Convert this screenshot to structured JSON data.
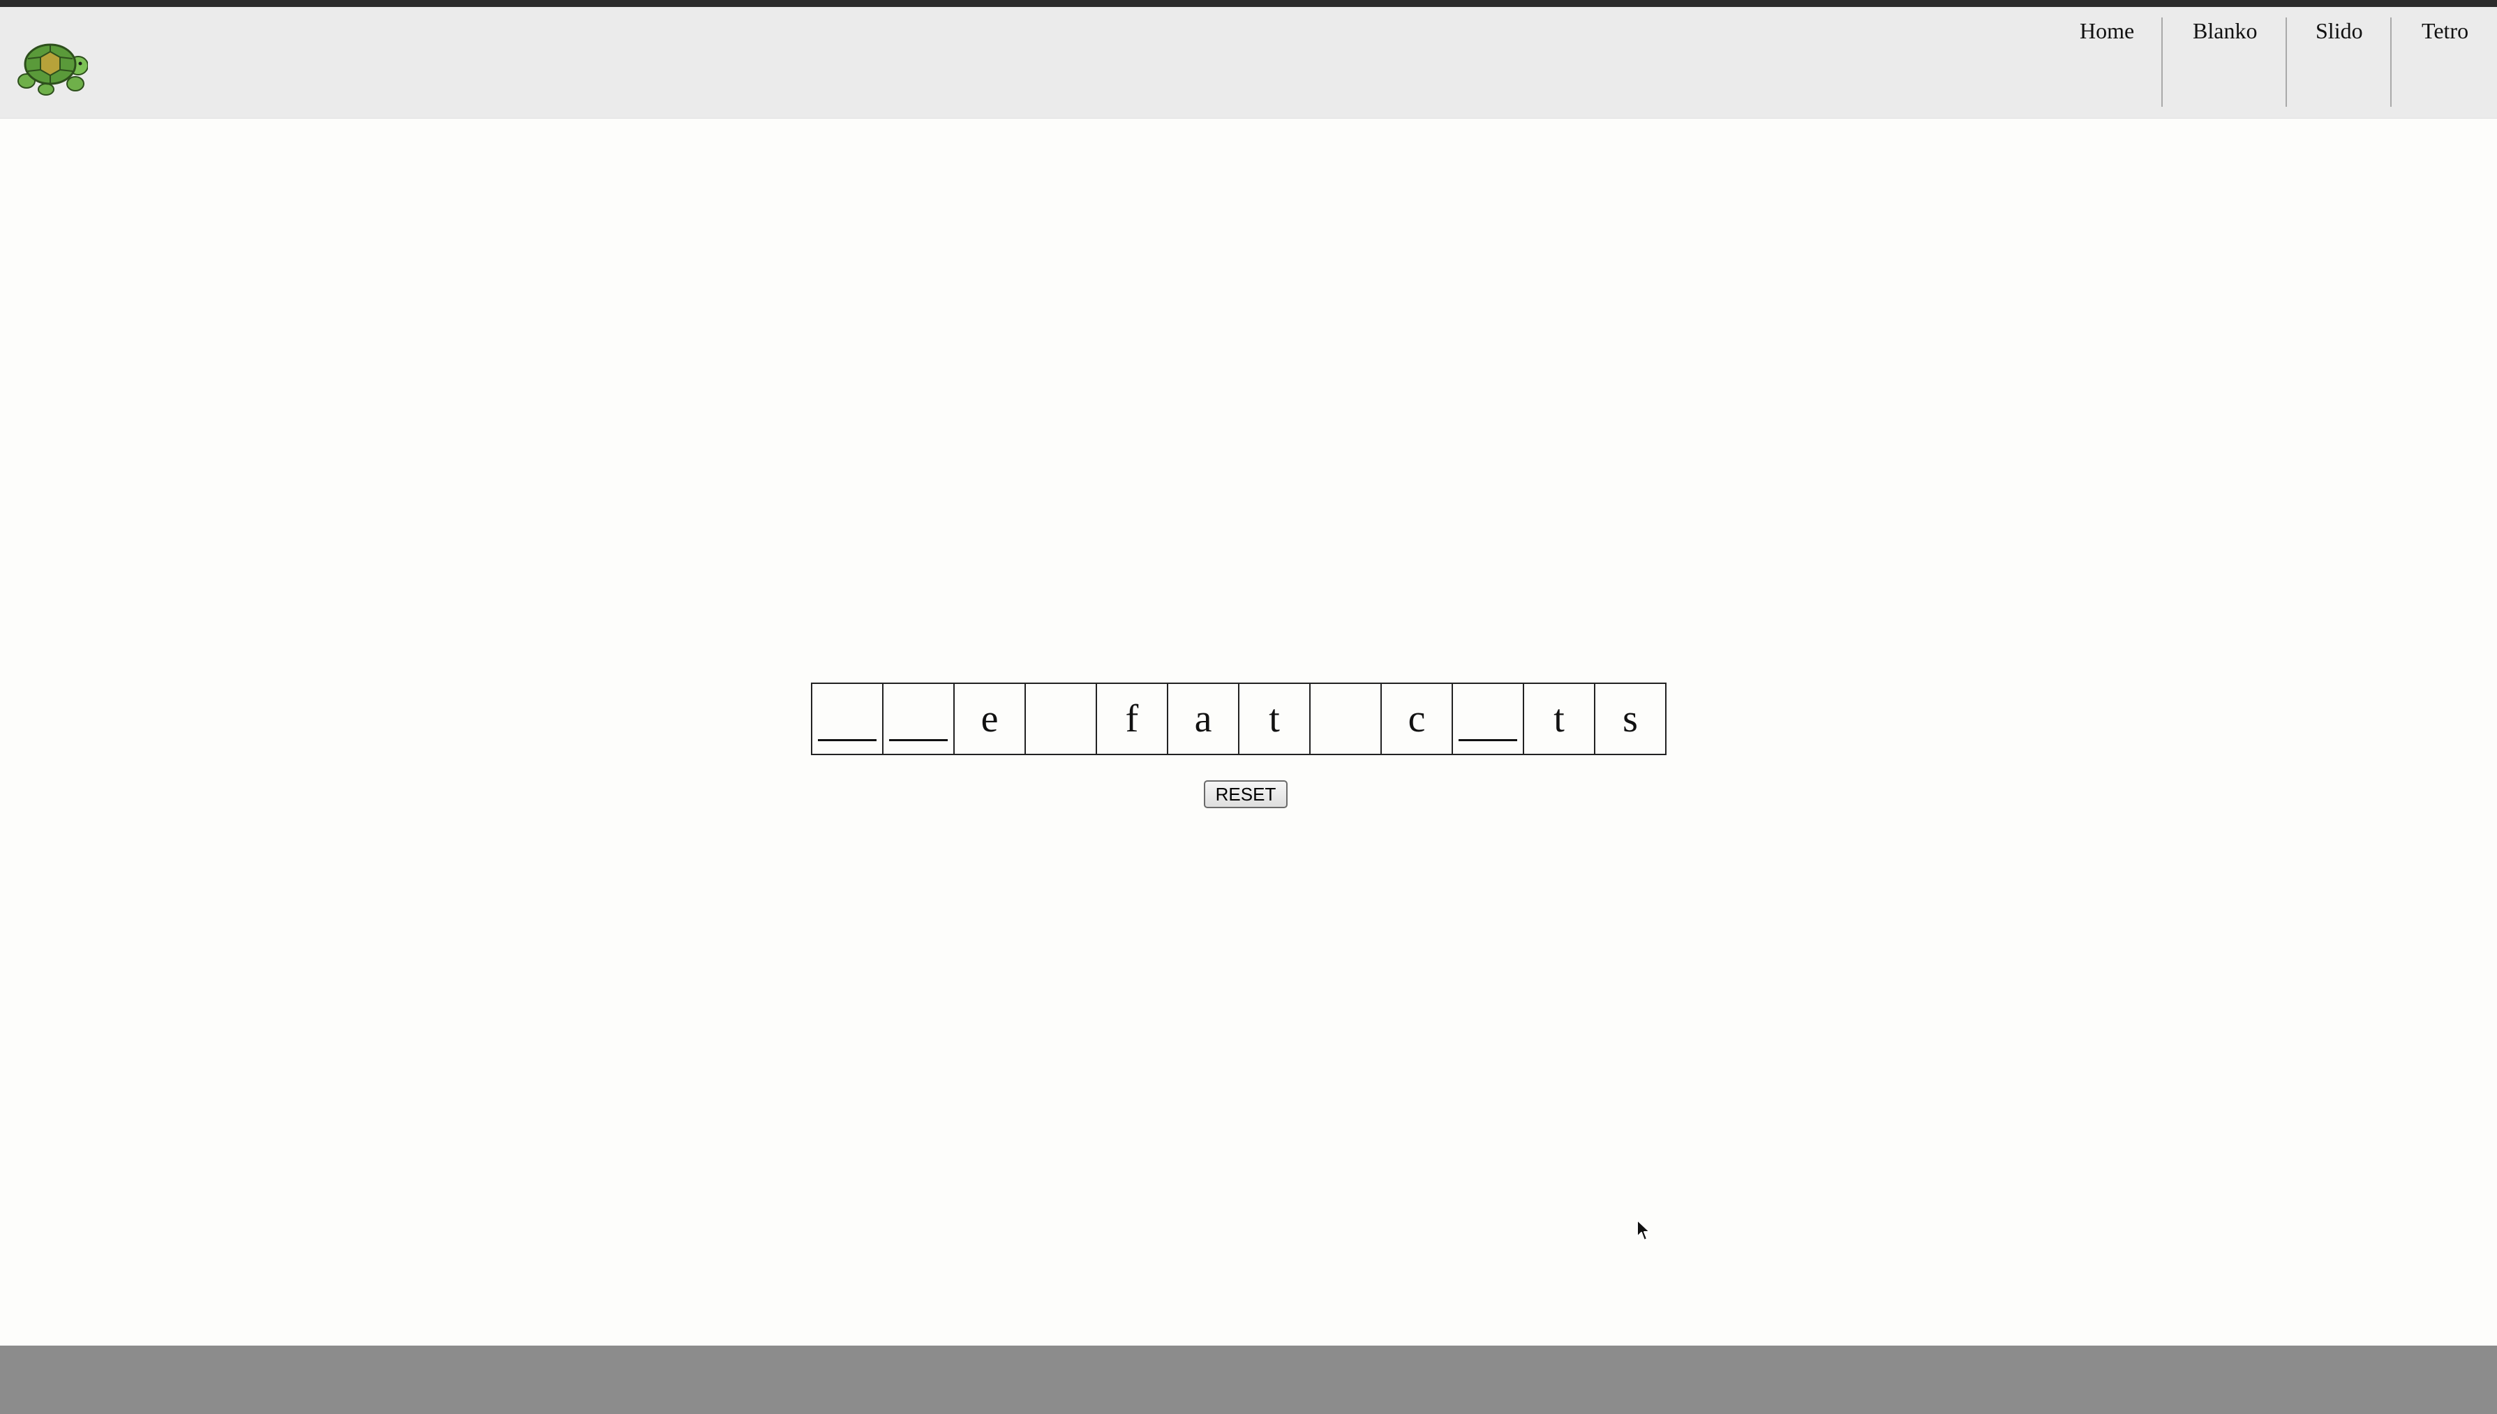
{
  "navbar": {
    "logo": "turtle-logo",
    "items": [
      {
        "label": "Home"
      },
      {
        "label": "Blanko"
      },
      {
        "label": "Slido"
      },
      {
        "label": "Tetro"
      }
    ]
  },
  "puzzle": {
    "cells": [
      {
        "letter": "",
        "blank": true
      },
      {
        "letter": "",
        "blank": true
      },
      {
        "letter": "e",
        "blank": false
      },
      {
        "letter": "",
        "blank": false
      },
      {
        "letter": "f",
        "blank": false
      },
      {
        "letter": "a",
        "blank": false
      },
      {
        "letter": "t",
        "blank": false
      },
      {
        "letter": "",
        "blank": false
      },
      {
        "letter": "c",
        "blank": false
      },
      {
        "letter": "",
        "blank": true
      },
      {
        "letter": "t",
        "blank": false
      },
      {
        "letter": "s",
        "blank": false
      }
    ],
    "reset_label": "RESET"
  },
  "colors": {
    "navbar_bg": "#ebebeb",
    "page_bg": "#fdfdfb",
    "footer_bg": "#8c8c8c",
    "turtle_green": "#5a9a3a"
  }
}
